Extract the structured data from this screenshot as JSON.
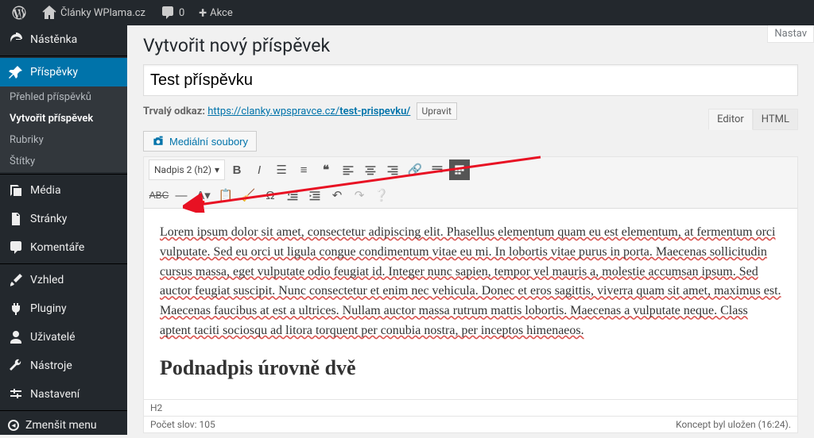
{
  "adminbar": {
    "site_name": "Články WPlama.cz",
    "comments_count": "0",
    "new_label": "Akce"
  },
  "sidebar": {
    "dashboard": "Nástěnka",
    "posts": "Příspěvky",
    "posts_submenu": {
      "all": "Přehled příspěvků",
      "new": "Vytvořit příspěvek",
      "cats": "Rubriky",
      "tags": "Štítky"
    },
    "media": "Média",
    "pages": "Stránky",
    "comments": "Komentáře",
    "appearance": "Vzhled",
    "plugins": "Pluginy",
    "users": "Uživatelé",
    "tools": "Nástroje",
    "settings": "Nastavení",
    "collapse": "Zmenšit menu"
  },
  "screen_options": "Nastav",
  "page_title": "Vytvořit nový příspěvek",
  "post_title": "Test příspěvku",
  "permalink": {
    "label": "Trvalý odkaz:",
    "base": "https://clanky.wpspravce.cz/",
    "slug": "test-prispevku/",
    "edit": "Upravit"
  },
  "media_button": "Mediální soubory",
  "editor_tabs": {
    "visual": "Editor",
    "text": "HTML"
  },
  "toolbar": {
    "format": "Nadpis 2 (h2)"
  },
  "body": {
    "para": "Lorem ipsum dolor sit amet, consectetur adipiscing elit. Phasellus elementum quam eu est elementum, at fermentum orci vulputate. Sed eu orci ut ligula congue condimentum vitae eu mi. In lobortis vitae purus in porta. Maecenas sollicitudin cursus massa, eget vulputate odio feugiat id. Integer nunc sapien, tempor vel mauris a, molestie accumsan ipsum. Sed auctor feugiat suscipit. Nunc consectetur et enim nec vehicula. Donec et eros sagittis, viverra quam sit amet, maximus est. Maecenas faucibus at est a ultrices. Nullam auctor massa rutrum mattis lobortis. Maecenas a vulputate neque. Class aptent taciti sociosqu ad litora torquent per conubia nostra, per inceptos himenaeos.",
    "h2": "Podnadpis úrovně dvě"
  },
  "status": {
    "path": "H2",
    "words_label": "Počet slov:",
    "words": "105",
    "saved": "Koncept byl uložen (16:24)."
  }
}
